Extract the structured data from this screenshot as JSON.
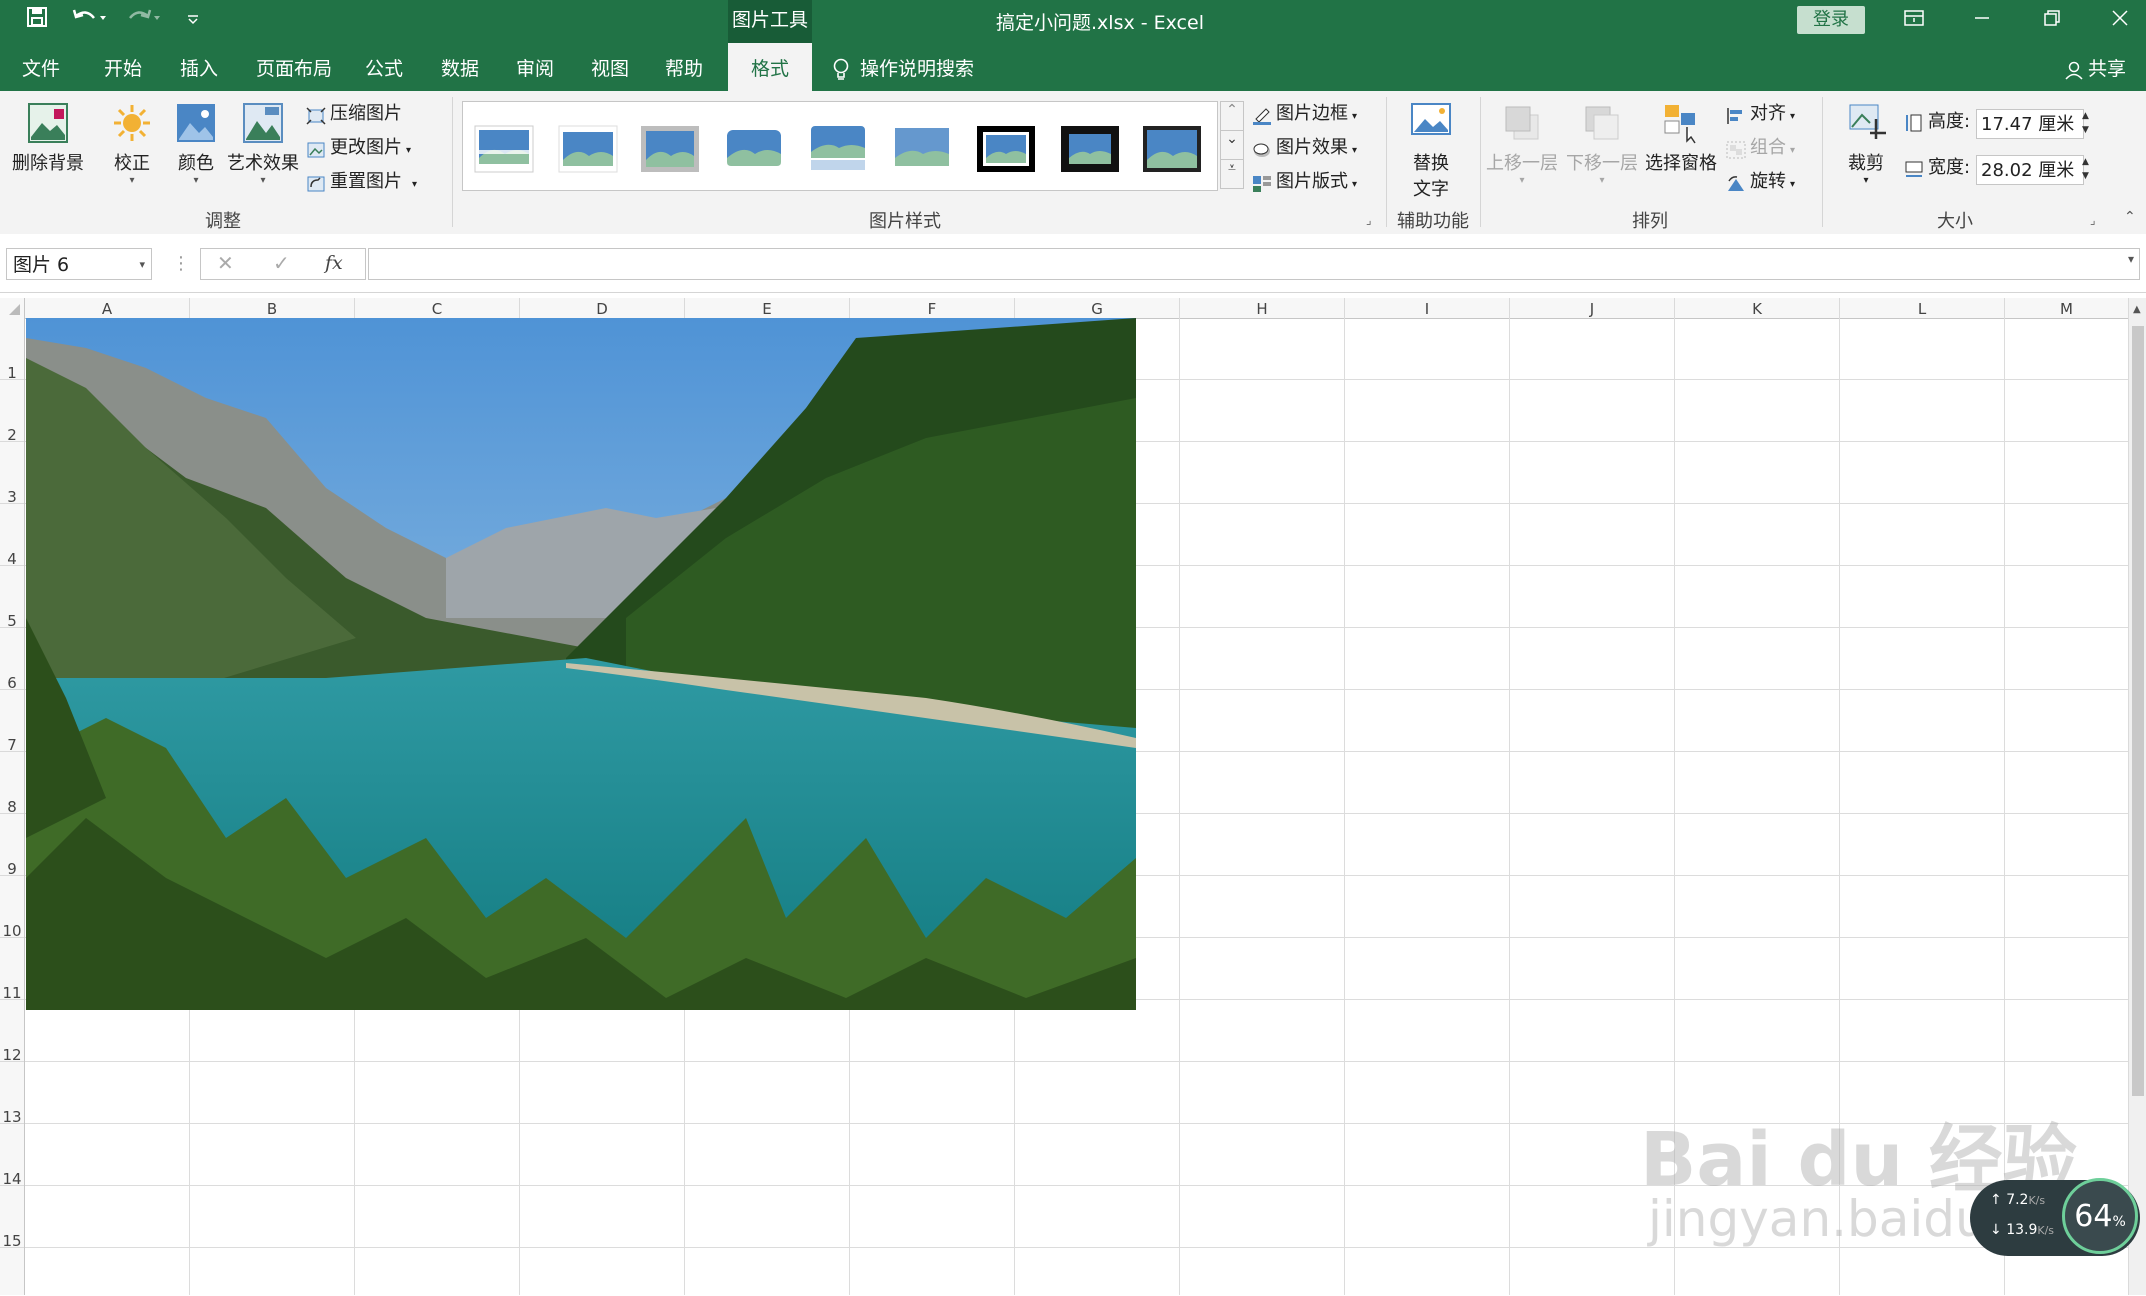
{
  "titlebar": {
    "contextual_tab": "图片工具",
    "document_title": "搞定小问题.xlsx  -  Excel",
    "login": "登录",
    "save_icon": "save-icon",
    "undo_icon": "undo-icon",
    "redo_icon": "redo-icon"
  },
  "tabs": [
    {
      "label": "文件"
    },
    {
      "label": "开始"
    },
    {
      "label": "插入"
    },
    {
      "label": "页面布局"
    },
    {
      "label": "公式"
    },
    {
      "label": "数据"
    },
    {
      "label": "审阅"
    },
    {
      "label": "视图"
    },
    {
      "label": "帮助"
    },
    {
      "label": "格式",
      "active": true
    }
  ],
  "tell_me": "操作说明搜索",
  "share": "共享",
  "ribbon": {
    "remove_bg": "删除背景",
    "corrections": "校正",
    "color": "颜色",
    "artistic": "艺术效果",
    "compress": "压缩图片",
    "change": "更改图片",
    "reset": "重置图片",
    "group_adjust": "调整",
    "border": "图片边框",
    "effects": "图片效果",
    "layout": "图片版式",
    "group_styles": "图片样式",
    "alt_text_line1": "替换",
    "alt_text_line2": "文字",
    "group_access": "辅助功能",
    "bring_forward": "上移一层",
    "send_backward": "下移一层",
    "selection_pane": "选择窗格",
    "align": "对齐",
    "group": "组合",
    "rotate": "旋转",
    "group_arrange": "排列",
    "crop": "裁剪",
    "height_label": "高度:",
    "height_value": "17.47 厘米",
    "width_label": "宽度:",
    "width_value": "28.02 厘米",
    "group_size": "大小"
  },
  "formula_bar": {
    "name_box": "图片 6",
    "cancel": "✕",
    "enter": "✓",
    "fx": "fx",
    "formula": ""
  },
  "columns": [
    "A",
    "B",
    "C",
    "D",
    "E",
    "F",
    "G",
    "H",
    "I",
    "J",
    "K",
    "L",
    "M"
  ],
  "rows": [
    "1",
    "2",
    "3",
    "4",
    "5",
    "6",
    "7",
    "8",
    "9",
    "10",
    "11",
    "12",
    "13",
    "14",
    "15"
  ],
  "watermark": {
    "brand": "Bai du 经验",
    "url": "jingyan.baidu.com"
  },
  "network_widget": {
    "up": "7.2",
    "up_unit": "K/s",
    "down": "13.9",
    "down_unit": "K/s",
    "percent": "64",
    "percent_sign": "%"
  }
}
